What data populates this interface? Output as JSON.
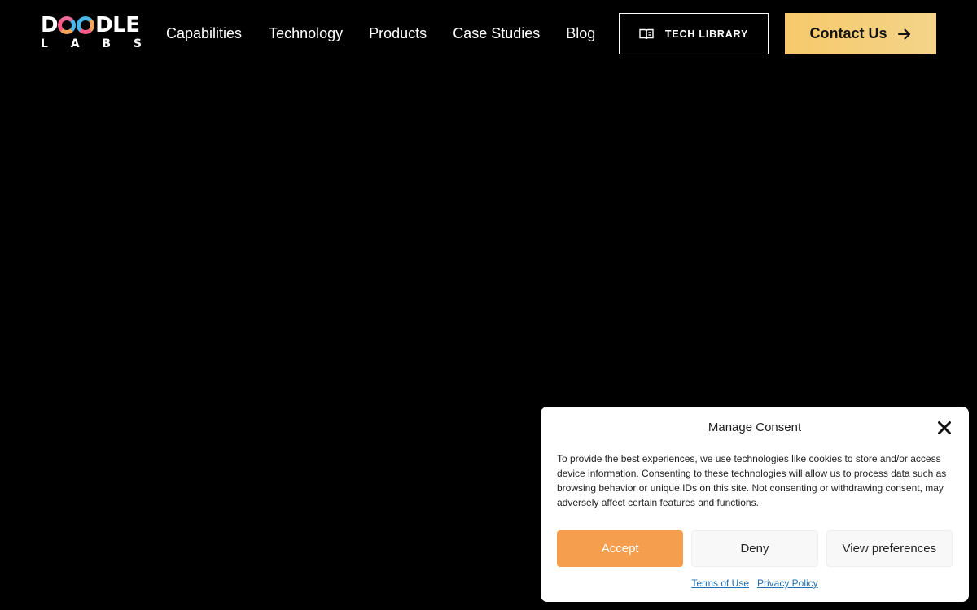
{
  "header": {
    "logo": {
      "top_text": "DOODLE",
      "bottom_letters": [
        "L",
        "A",
        "B",
        "S"
      ]
    },
    "nav": [
      {
        "label": "Capabilities"
      },
      {
        "label": "Technology"
      },
      {
        "label": "Products"
      },
      {
        "label": "Case Studies"
      },
      {
        "label": "Blog"
      }
    ],
    "tech_library_label": "TECH LIBRARY",
    "contact_label": "Contact Us"
  },
  "consent": {
    "title": "Manage Consent",
    "body": "To provide the best experiences, we use technologies like cookies to store and/or access device information. Consenting to these technologies will allow us to process data such as browsing behavior or unique IDs on this site. Not consenting or withdrawing consent, may adversely affect certain features and functions.",
    "accept_label": "Accept",
    "deny_label": "Deny",
    "preferences_label": "View preferences",
    "links": {
      "terms": "Terms of Use",
      "privacy": "Privacy Policy"
    }
  },
  "colors": {
    "background": "#000000",
    "contact_button": "#f7c96b",
    "accept_button": "#f59f4e",
    "link": "#1f6fb5"
  },
  "icons": {
    "tech_library": "book-icon",
    "contact": "arrow-right-icon",
    "close": "close-icon"
  }
}
